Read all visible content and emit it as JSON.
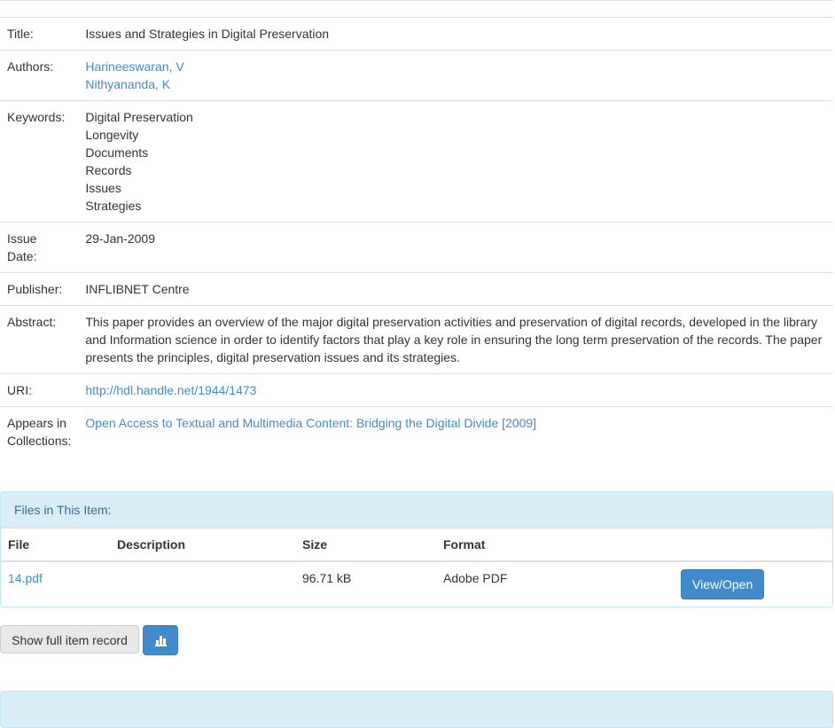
{
  "item": {
    "title_label": "Title:",
    "title": "Issues and Strategies in Digital Preservation",
    "authors_label": "Authors:",
    "authors": [
      "Harineeswaran, V",
      "Nithyananda, K"
    ],
    "keywords_label": "Keywords:",
    "keywords": [
      "Digital Preservation",
      "Longevity",
      "Documents",
      "Records",
      "Issues",
      "Strategies"
    ],
    "issue_date_label_1": "Issue",
    "issue_date_label_2": "Date:",
    "issue_date": "29-Jan-2009",
    "publisher_label": "Publisher:",
    "publisher": "INFLIBNET Centre",
    "abstract_label": "Abstract:",
    "abstract": "This paper provides an overview of the major digital preservation activities and preservation of digital records, developed in the library and Information science in order to identify factors that play a key role in ensuring the long term preservation of the records. The paper presents the principles, digital preservation issues and its strategies.",
    "uri_label": "URI:",
    "uri": "http://hdl.handle.net/1944/1473",
    "collections_label_1": "Appears in",
    "collections_label_2": "Collections:",
    "collection": "Open Access to Textual and Multimedia Content: Bridging the Digital Divide [2009]"
  },
  "files": {
    "heading": "Files in This Item:",
    "columns": [
      "File",
      "Description",
      "Size",
      "Format"
    ],
    "rows": [
      {
        "file": "14.pdf",
        "description": "",
        "size": "96.71 kB",
        "format": "Adobe PDF",
        "action": "View/Open"
      }
    ]
  },
  "actions": {
    "full_record": "Show full item record",
    "stats_icon": "bar-chart-icon"
  },
  "colors": {
    "link": "#428bca",
    "panel_heading_bg": "#d9edf7",
    "panel_heading_text": "#31708f",
    "primary": "#428bca"
  }
}
